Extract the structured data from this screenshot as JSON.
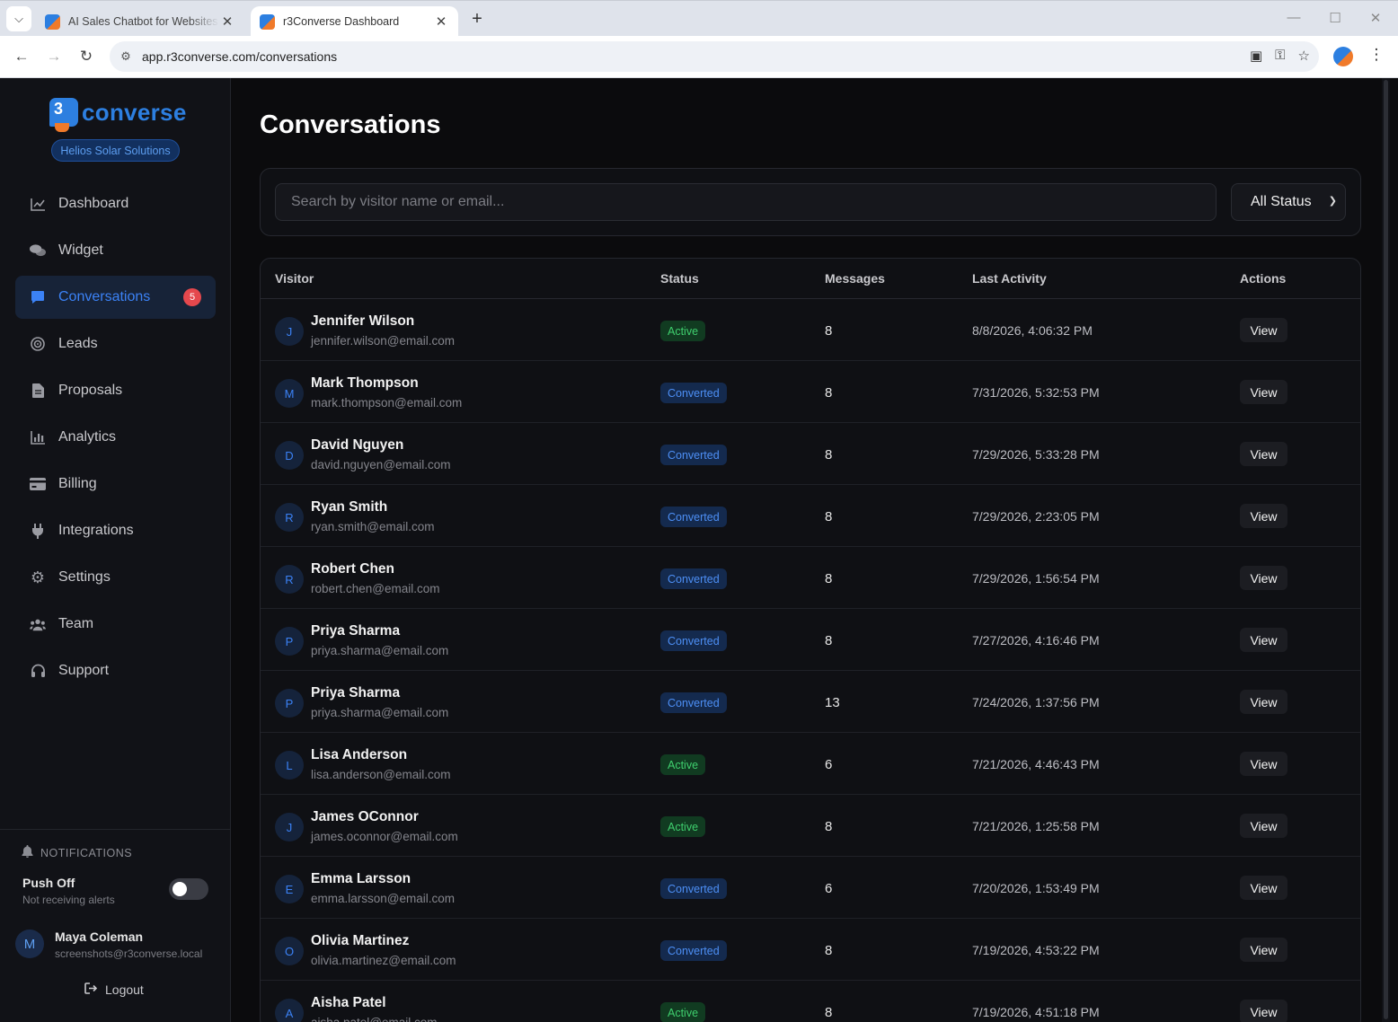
{
  "browser": {
    "tabs": [
      {
        "title": "AI Sales Chatbot for Websites – ",
        "active": false
      },
      {
        "title": "r3Converse Dashboard",
        "active": true
      }
    ],
    "url": "app.r3converse.com/conversations"
  },
  "sidebar": {
    "logo_mark": "3",
    "logo_text": "converse",
    "org_name": "Helios Solar Solutions",
    "nav": [
      {
        "label": "Dashboard",
        "icon": "chart-line-icon"
      },
      {
        "label": "Widget",
        "icon": "chat-bubbles-icon"
      },
      {
        "label": "Conversations",
        "icon": "comment-icon",
        "active": true,
        "badge": "5"
      },
      {
        "label": "Leads",
        "icon": "target-icon"
      },
      {
        "label": "Proposals",
        "icon": "document-icon"
      },
      {
        "label": "Analytics",
        "icon": "bar-chart-icon"
      },
      {
        "label": "Billing",
        "icon": "credit-card-icon"
      },
      {
        "label": "Integrations",
        "icon": "plug-icon"
      },
      {
        "label": "Settings",
        "icon": "gear-icon"
      },
      {
        "label": "Team",
        "icon": "users-icon"
      },
      {
        "label": "Support",
        "icon": "headset-icon"
      }
    ],
    "notifications": {
      "heading": "NOTIFICATIONS",
      "push_title": "Push Off",
      "push_subtitle": "Not receiving alerts"
    },
    "user": {
      "initial": "M",
      "name": "Maya Coleman",
      "email": "screenshots@r3converse.local"
    },
    "logout_label": "Logout"
  },
  "main": {
    "title": "Conversations",
    "search_placeholder": "Search by visitor name or email...",
    "status_filter": "All Status",
    "columns": [
      "Visitor",
      "Status",
      "Messages",
      "Last Activity",
      "Actions"
    ],
    "rows": [
      {
        "initial": "J",
        "name": "Jennifer Wilson",
        "email": "jennifer.wilson@email.com",
        "status": "Active",
        "messages": "8",
        "last_activity": "8/8/2026, 4:06:32 PM",
        "action": "View"
      },
      {
        "initial": "M",
        "name": "Mark Thompson",
        "email": "mark.thompson@email.com",
        "status": "Converted",
        "messages": "8",
        "last_activity": "7/31/2026, 5:32:53 PM",
        "action": "View"
      },
      {
        "initial": "D",
        "name": "David Nguyen",
        "email": "david.nguyen@email.com",
        "status": "Converted",
        "messages": "8",
        "last_activity": "7/29/2026, 5:33:28 PM",
        "action": "View"
      },
      {
        "initial": "R",
        "name": "Ryan Smith",
        "email": "ryan.smith@email.com",
        "status": "Converted",
        "messages": "8",
        "last_activity": "7/29/2026, 2:23:05 PM",
        "action": "View"
      },
      {
        "initial": "R",
        "name": "Robert Chen",
        "email": "robert.chen@email.com",
        "status": "Converted",
        "messages": "8",
        "last_activity": "7/29/2026, 1:56:54 PM",
        "action": "View"
      },
      {
        "initial": "P",
        "name": "Priya Sharma",
        "email": "priya.sharma@email.com",
        "status": "Converted",
        "messages": "8",
        "last_activity": "7/27/2026, 4:16:46 PM",
        "action": "View"
      },
      {
        "initial": "P",
        "name": "Priya Sharma",
        "email": "priya.sharma@email.com",
        "status": "Converted",
        "messages": "13",
        "last_activity": "7/24/2026, 1:37:56 PM",
        "action": "View"
      },
      {
        "initial": "L",
        "name": "Lisa Anderson",
        "email": "lisa.anderson@email.com",
        "status": "Active",
        "messages": "6",
        "last_activity": "7/21/2026, 4:46:43 PM",
        "action": "View"
      },
      {
        "initial": "J",
        "name": "James OConnor",
        "email": "james.oconnor@email.com",
        "status": "Active",
        "messages": "8",
        "last_activity": "7/21/2026, 1:25:58 PM",
        "action": "View"
      },
      {
        "initial": "E",
        "name": "Emma Larsson",
        "email": "emma.larsson@email.com",
        "status": "Converted",
        "messages": "6",
        "last_activity": "7/20/2026, 1:53:49 PM",
        "action": "View"
      },
      {
        "initial": "O",
        "name": "Olivia Martinez",
        "email": "olivia.martinez@email.com",
        "status": "Converted",
        "messages": "8",
        "last_activity": "7/19/2026, 4:53:22 PM",
        "action": "View"
      },
      {
        "initial": "A",
        "name": "Aisha Patel",
        "email": "aisha.patel@email.com",
        "status": "Active",
        "messages": "8",
        "last_activity": "7/19/2026, 4:51:18 PM",
        "action": "View"
      }
    ]
  },
  "colors": {
    "accent": "#3b82f6",
    "active_status": "#3fcf6e",
    "converted_status": "#4d8ff5",
    "badge_red": "#e5484d"
  }
}
